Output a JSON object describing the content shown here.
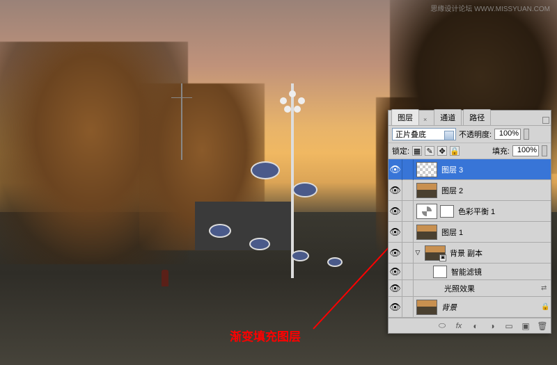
{
  "watermark": "思缘设计论坛    WWW.MISSYUAN.COM",
  "annotation": "渐变填充图层",
  "panel": {
    "tabs": {
      "layers": "图层",
      "channels": "通道",
      "paths": "路径"
    },
    "blend_mode": "正片叠底",
    "opacity_label": "不透明度:",
    "opacity_value": "100%",
    "lock_label": "锁定:",
    "fill_label": "填充:",
    "fill_value": "100%"
  },
  "layers": {
    "l3": "图层 3",
    "l2": "图层 2",
    "cb": "色彩平衡 1",
    "l1": "图层 1",
    "bgcopy": "背景 副本",
    "smart": "智能滤镜",
    "lighting": "光照效果",
    "bg": "背景"
  }
}
